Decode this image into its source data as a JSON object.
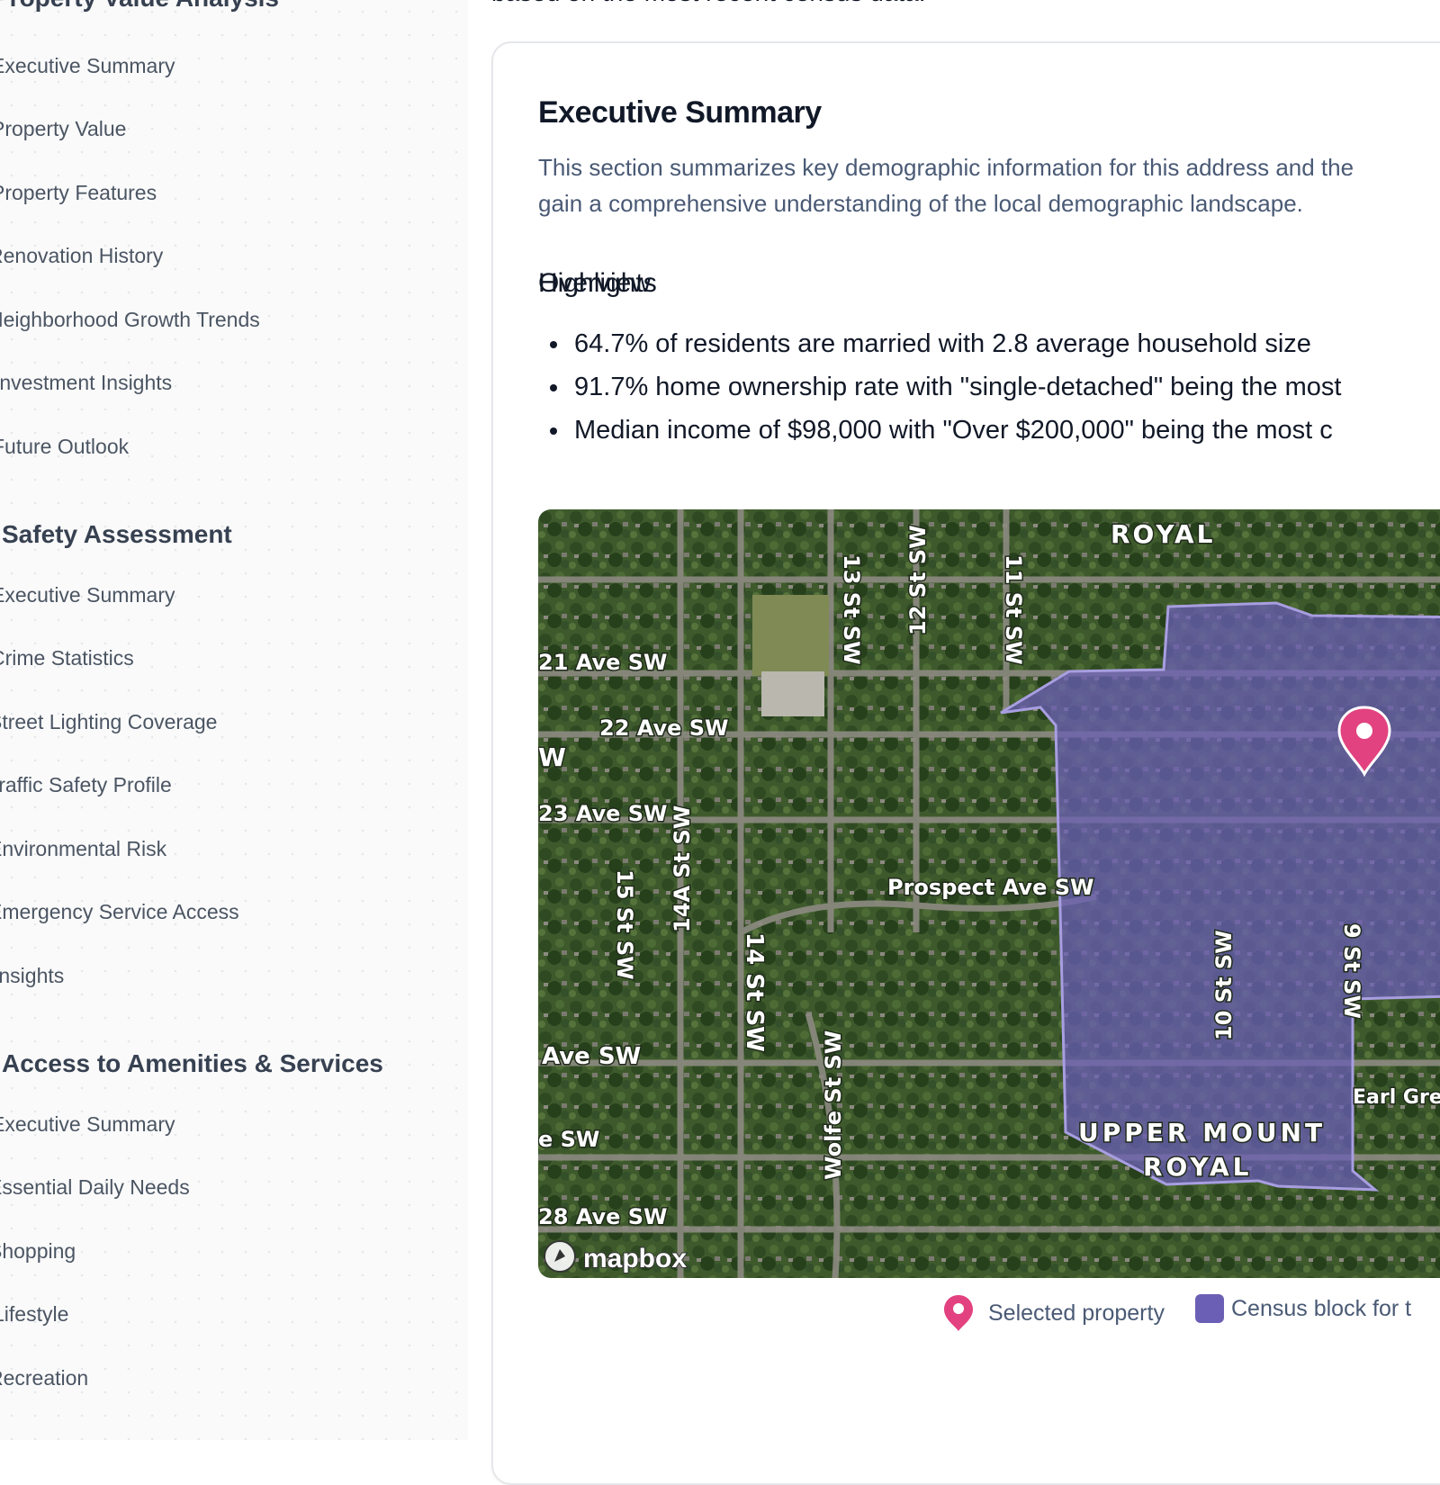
{
  "sidebar": {
    "sections": [
      {
        "title": "Property Value Analysis",
        "items": [
          "Executive Summary",
          "Property Value",
          "Property Features",
          "Renovation History",
          "Neighborhood Growth Trends",
          "Investment Insights",
          "Future Outlook"
        ]
      },
      {
        "title": "Safety Assessment",
        "items": [
          "Executive Summary",
          "Crime Statistics",
          "Street Lighting Coverage",
          "Traffic Safety Profile",
          "Environmental Risk",
          "Emergency Service Access",
          "Insights"
        ]
      },
      {
        "title": "Access to Amenities & Services",
        "items": [
          "Executive Summary",
          "Essential Daily Needs",
          "Shopping",
          "Lifestyle",
          "Recreation"
        ]
      }
    ]
  },
  "intro": {
    "partial_text": "based on the most recent census data."
  },
  "card": {
    "title": "Executive Summary",
    "description_line1": "This section summarizes key demographic information for this address and the",
    "description_line2": "gain a comprehensive understanding of the local demographic landscape.",
    "highlights_title": "Highlights",
    "highlights": [
      "64.7% of residents are married with 2.8 average household size",
      "91.7% home ownership rate with \"single-detached\" being the most",
      "Median income of $98,000 with \"Over $200,000\" being the most c"
    ],
    "overview_title": "Overview"
  },
  "map": {
    "streets": [
      "13 St SW",
      "12 St SW",
      "11 St SW",
      "21 Ave SW",
      "22 Ave SW",
      "W",
      "23 Ave SW",
      "15 St SW",
      "14A St SW",
      "Prospect Ave SW",
      "14 St SW",
      "Ave SW",
      "Wolfe St SW",
      "e SW",
      "28 Ave SW",
      "10 St SW",
      "9 St SW"
    ],
    "neighborhoods": [
      "ROYAL",
      "UPPER MOUNT",
      "ROYAL"
    ],
    "places": [
      "Earl Gre"
    ],
    "attribution": "mapbox",
    "colors": {
      "census_fill": "#6b5fb5",
      "pin": "#e2427f"
    }
  },
  "legend": {
    "selected_property": "Selected property",
    "census_block": "Census block for t"
  }
}
